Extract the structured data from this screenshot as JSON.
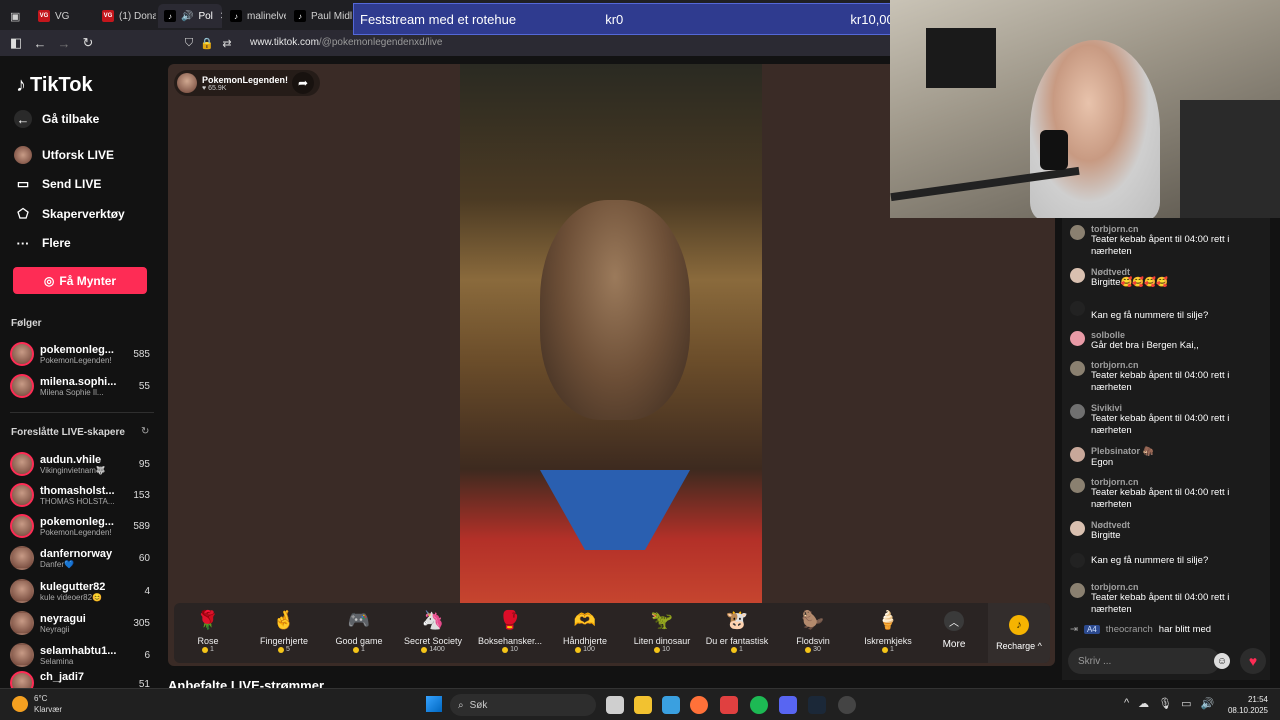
{
  "browser": {
    "tabs": [
      {
        "label": "VG",
        "favicon": "vg"
      },
      {
        "label": "(1) Donal",
        "favicon": "vg"
      },
      {
        "label": "Pol",
        "favicon": "tiktok",
        "active": true
      },
      {
        "label": "malinelve",
        "favicon": "tiktok"
      },
      {
        "label": "Paul Midl",
        "favicon": "tiktok"
      }
    ],
    "url_host": "www.tiktok.com",
    "url_path": "/@pokemonlegendenxd/live"
  },
  "banner": {
    "title": "Feststream med et rotehue",
    "current": "kr0",
    "goal": "kr10,000"
  },
  "sidebar": {
    "logo": "TikTok",
    "back": "Gå tilbake",
    "nav": [
      {
        "label": "Utforsk LIVE",
        "icon": "live-avatar-icon"
      },
      {
        "label": "Send LIVE",
        "icon": "camera-icon"
      },
      {
        "label": "Skaperverktøy",
        "icon": "creator-tools-icon"
      },
      {
        "label": "Flere",
        "icon": "more-dots-icon"
      }
    ],
    "coins_button": "Få Mynter",
    "following_title": "Følger",
    "following": [
      {
        "name": "pokemonleg...",
        "sub": "PokemonLegenden!",
        "count": "585"
      },
      {
        "name": "milena.sophi...",
        "sub": "Milena Sophie Il...",
        "count": "55"
      }
    ],
    "suggested_title": "Foreslåtte LIVE-skapere",
    "suggested": [
      {
        "name": "audun.vhile",
        "sub": "Vikinginvietnam🐺",
        "count": "95"
      },
      {
        "name": "thomasholst...",
        "sub": "THOMAS HOLSTA...",
        "count": "153"
      },
      {
        "name": "pokemonleg...",
        "sub": "PokemonLegenden!",
        "count": "589"
      },
      {
        "name": "danfernorway",
        "sub": "Danfer💙",
        "count": "60"
      },
      {
        "name": "kulegutter82",
        "sub": "kule videoer82😊",
        "count": "4"
      },
      {
        "name": "neyragui",
        "sub": "Neyragii",
        "count": "305"
      },
      {
        "name": "selamhabtu1...",
        "sub": "Selamina",
        "count": "6"
      },
      {
        "name": "ch_jadi7",
        "sub": "",
        "count": "51"
      }
    ]
  },
  "stream": {
    "host_name": "PokemonLegenden!",
    "host_likes": "65.9K"
  },
  "gifts": [
    {
      "name": "Rose",
      "price": "1",
      "icon": "🌹"
    },
    {
      "name": "Fingerhjerte",
      "price": "5",
      "icon": "🤞"
    },
    {
      "name": "Good game",
      "price": "1",
      "icon": "🎮"
    },
    {
      "name": "Secret Society",
      "price": "1400",
      "icon": "🦄"
    },
    {
      "name": "Boksehansker...",
      "price": "10",
      "icon": "🥊"
    },
    {
      "name": "Håndhjerte",
      "price": "100",
      "icon": "🫶"
    },
    {
      "name": "Liten dinosaur",
      "price": "10",
      "icon": "🦖"
    },
    {
      "name": "Du er fantastisk",
      "price": "1",
      "icon": "🐮"
    },
    {
      "name": "Flodsvin",
      "price": "30",
      "icon": "🦫"
    },
    {
      "name": "Iskremkjeks",
      "price": "1",
      "icon": "🍦"
    }
  ],
  "gift_more": "More",
  "recharge": "Recharge",
  "recommended_title": "Anbefalte LIVE-strømmer",
  "chat": {
    "messages": [
      {
        "user": "torbjorn.cn",
        "text": "Teater kebab åpent til 04:00 rett i nærheten"
      },
      {
        "user": "Nødtvedt",
        "text": "Birgitte🥰🥰🥰🥰"
      },
      {
        "user": "",
        "text": "Kan eg få nummere til silje?"
      },
      {
        "user": "solbolle",
        "text": "Går det bra i Bergen Kai,,"
      },
      {
        "user": "torbjorn.cn",
        "text": "Teater kebab åpent til 04:00 rett i nærheten"
      },
      {
        "user": "Sivikivi",
        "text": "Teater kebab åpent til 04:00 rett i nærheten"
      },
      {
        "user": "Plebsinator 🦣",
        "text": "Egon"
      },
      {
        "user": "torbjorn.cn",
        "text": "Teater kebab åpent til 04:00 rett i nærheten"
      },
      {
        "user": "Nødtvedt",
        "text": "Birgitte"
      },
      {
        "user": "",
        "text": "Kan eg få nummere til silje?"
      },
      {
        "user": "torbjorn.cn",
        "text": "Teater kebab åpent til 04:00 rett i nærheten"
      }
    ],
    "joined_badge": "A4",
    "joined_user": "theocranch",
    "joined_text": "har blitt med",
    "input_placeholder": "Skriv ..."
  },
  "taskbar": {
    "weather_temp": "6°C",
    "weather_desc": "Klarvær",
    "search_label": "Søk",
    "time": "21:54",
    "date": "08.10.2025"
  },
  "colors": {
    "accent": "#fe2c55",
    "banner": "#2f3b8f",
    "coin": "#f5c518"
  }
}
